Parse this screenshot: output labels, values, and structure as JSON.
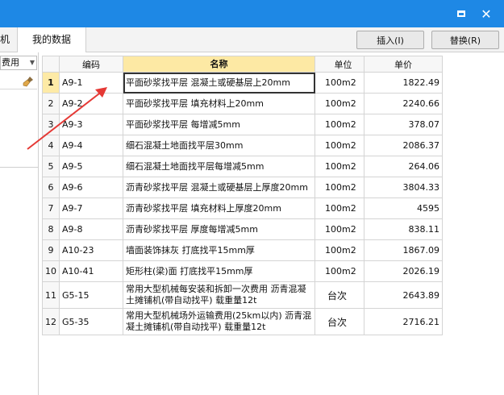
{
  "window": {
    "minimize": "",
    "close": "✕"
  },
  "toolbar": {
    "left_tab": "机",
    "my_data_tab": "我的数据",
    "insert_label": "插入(I)",
    "replace_label": "替换(R)"
  },
  "left": {
    "combo_value": "费用"
  },
  "table": {
    "headers": [
      "",
      "编码",
      "名称",
      "单位",
      "单价"
    ],
    "rows": [
      {
        "idx": "1",
        "code": "A9-1",
        "name": "平面砂浆找平层 混凝土或硬基层上20mm",
        "unit": "100m2",
        "price": "1822.49"
      },
      {
        "idx": "2",
        "code": "A9-2",
        "name": "平面砂浆找平层 填充材料上20mm",
        "unit": "100m2",
        "price": "2240.66"
      },
      {
        "idx": "3",
        "code": "A9-3",
        "name": "平面砂浆找平层 每增减5mm",
        "unit": "100m2",
        "price": "378.07"
      },
      {
        "idx": "4",
        "code": "A9-4",
        "name": "细石混凝土地面找平层30mm",
        "unit": "100m2",
        "price": "2086.37"
      },
      {
        "idx": "5",
        "code": "A9-5",
        "name": "细石混凝土地面找平层每增减5mm",
        "unit": "100m2",
        "price": "264.06"
      },
      {
        "idx": "6",
        "code": "A9-6",
        "name": "沥青砂浆找平层 混凝土或硬基层上厚度20mm",
        "unit": "100m2",
        "price": "3804.33"
      },
      {
        "idx": "7",
        "code": "A9-7",
        "name": "沥青砂浆找平层 填充材料上厚度20mm",
        "unit": "100m2",
        "price": "4595"
      },
      {
        "idx": "8",
        "code": "A9-8",
        "name": "沥青砂浆找平层 厚度每增减5mm",
        "unit": "100m2",
        "price": "838.11"
      },
      {
        "idx": "9",
        "code": "A10-23",
        "name": "墙面装饰抹灰 打底找平15mm厚",
        "unit": "100m2",
        "price": "1867.09"
      },
      {
        "idx": "10",
        "code": "A10-41",
        "name": "矩形柱(梁)面 打底找平15mm厚",
        "unit": "100m2",
        "price": "2026.19"
      },
      {
        "idx": "11",
        "code": "G5-15",
        "name": "常用大型机械每安装和拆卸一次费用 沥青混凝土摊铺机(带自动找平) 载重量12t",
        "unit": "台次",
        "price": "2643.89"
      },
      {
        "idx": "12",
        "code": "G5-35",
        "name": "常用大型机械场外运输费用(25km以内) 沥青混凝土摊铺机(带自动找平) 载重量12t",
        "unit": "台次",
        "price": "2716.21"
      }
    ]
  },
  "colors": {
    "titlebar": "#1e88e5",
    "header_highlight": "#fde9a4",
    "arrow": "#e53935"
  }
}
